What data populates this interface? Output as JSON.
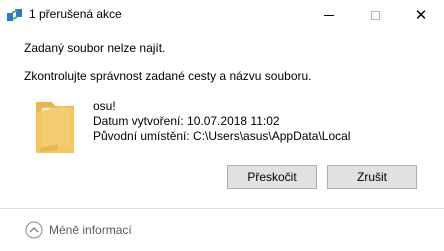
{
  "window": {
    "title": "1 přerušená akce",
    "controls": {
      "minimize_icon": "minimize-icon",
      "maximize_icon": "maximize-icon",
      "close_icon": "close-icon"
    }
  },
  "message": {
    "line1": "Zadaný soubor nelze najít.",
    "line2": "Zkontrolujte správnost zadané cesty a názvu souboru."
  },
  "file": {
    "icon": "folder-icon",
    "name": "osu!",
    "created": "Datum vytvoření: 10.07.2018 11:02",
    "location": "Původní umístění: C:\\Users\\asus\\AppData\\Local"
  },
  "buttons": {
    "skip": "Přeskočit",
    "cancel": "Zrušit"
  },
  "footer": {
    "toggle_label": "Méně informací",
    "toggle_icon": "chevron-up-circle-icon"
  },
  "colors": {
    "button_bg": "#e1e1e1",
    "button_border": "#adadad",
    "footer_text": "#5a5a5a",
    "folder": "#f3c964"
  }
}
